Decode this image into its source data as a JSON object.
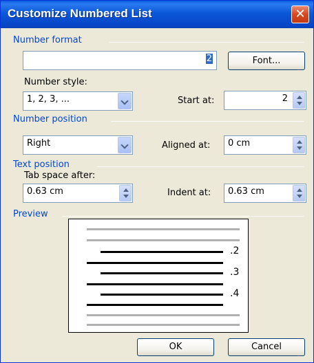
{
  "window": {
    "title": "Customize Numbered List",
    "close_label": "✕"
  },
  "number_format": {
    "section_label": "Number format",
    "value": "2",
    "font_button": "Font..."
  },
  "number_style": {
    "label": "Number style:",
    "value": "1, 2, 3, ..."
  },
  "start_at": {
    "label": "Start at:",
    "value": "2"
  },
  "number_position": {
    "section_label": "Number position",
    "value": "Right",
    "aligned_label": "Aligned at:",
    "aligned_value": "0 cm"
  },
  "text_position": {
    "section_label": "Text position",
    "tab_label": "Tab space after:",
    "tab_value": "0.63 cm",
    "indent_label": "Indent at:",
    "indent_value": "0.63 cm"
  },
  "preview": {
    "section_label": "Preview",
    "numbers": [
      ".2",
      ".3",
      ".4"
    ]
  },
  "buttons": {
    "ok": "OK",
    "cancel": "Cancel"
  },
  "colors": {
    "title_bar": "#0a58d8",
    "section_text": "#0046d5",
    "dialog_bg": "#ece9d8"
  }
}
